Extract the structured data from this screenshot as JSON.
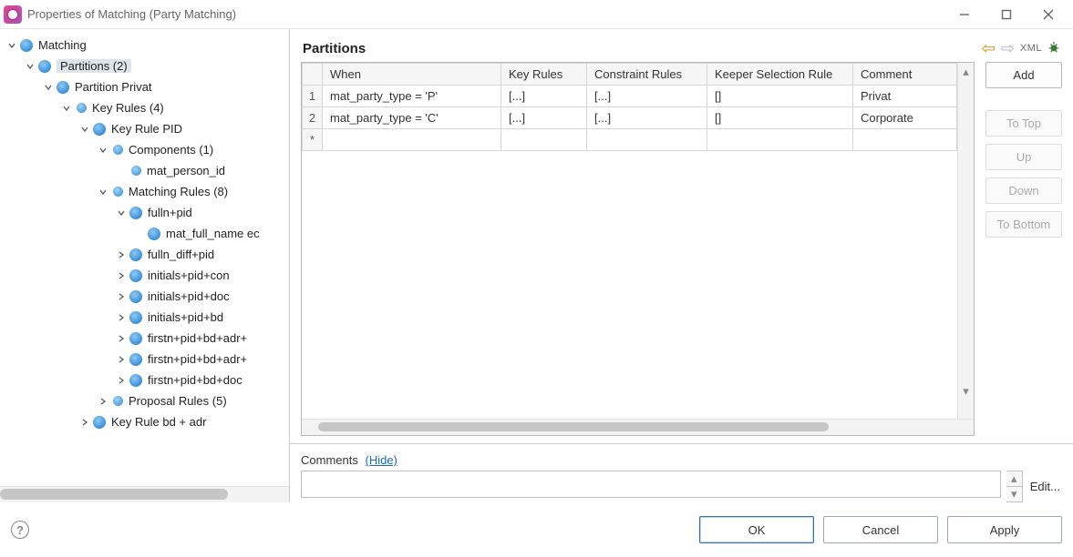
{
  "window": {
    "title": "Properties of Matching (Party Matching)"
  },
  "tree": {
    "nodes": [
      {
        "indent": 0,
        "exp": "open",
        "icon": "db",
        "label": "Matching",
        "sel": false
      },
      {
        "indent": 1,
        "exp": "open",
        "icon": "db",
        "label": "Partitions (2)",
        "sel": true
      },
      {
        "indent": 2,
        "exp": "open",
        "icon": "db",
        "label": "Partition Privat",
        "sel": false
      },
      {
        "indent": 3,
        "exp": "open",
        "icon": "sm",
        "label": "Key Rules (4)",
        "sel": false
      },
      {
        "indent": 4,
        "exp": "open",
        "icon": "db",
        "label": "Key Rule PID",
        "sel": false
      },
      {
        "indent": 5,
        "exp": "open",
        "icon": "sm",
        "label": "Components (1)",
        "sel": false
      },
      {
        "indent": 6,
        "exp": "none",
        "icon": "sm",
        "label": "mat_person_id",
        "sel": false
      },
      {
        "indent": 5,
        "exp": "open",
        "icon": "sm",
        "label": "Matching Rules (8)",
        "sel": false
      },
      {
        "indent": 6,
        "exp": "open",
        "icon": "db",
        "label": "fulln+pid",
        "sel": false
      },
      {
        "indent": 7,
        "exp": "none",
        "icon": "db",
        "label": "mat_full_name ec",
        "sel": false
      },
      {
        "indent": 6,
        "exp": "closed",
        "icon": "db",
        "label": "fulln_diff+pid",
        "sel": false
      },
      {
        "indent": 6,
        "exp": "closed",
        "icon": "db",
        "label": "initials+pid+con",
        "sel": false
      },
      {
        "indent": 6,
        "exp": "closed",
        "icon": "db",
        "label": "initials+pid+doc",
        "sel": false
      },
      {
        "indent": 6,
        "exp": "closed",
        "icon": "db",
        "label": "initials+pid+bd",
        "sel": false
      },
      {
        "indent": 6,
        "exp": "closed",
        "icon": "db",
        "label": "firstn+pid+bd+adr+",
        "sel": false
      },
      {
        "indent": 6,
        "exp": "closed",
        "icon": "db",
        "label": "firstn+pid+bd+adr+",
        "sel": false
      },
      {
        "indent": 6,
        "exp": "closed",
        "icon": "db",
        "label": "firstn+pid+bd+doc",
        "sel": false
      },
      {
        "indent": 5,
        "exp": "closed",
        "icon": "sm",
        "label": "Proposal Rules (5)",
        "sel": false
      },
      {
        "indent": 4,
        "exp": "closed",
        "icon": "db",
        "label": "Key Rule bd + adr",
        "sel": false
      }
    ]
  },
  "right": {
    "heading": "Partitions",
    "xml_label": "XML"
  },
  "table": {
    "columns": [
      "When",
      "Key Rules",
      "Constraint Rules",
      "Keeper Selection Rule",
      "Comment"
    ],
    "rows": [
      {
        "num": "1",
        "when": "mat_party_type = 'P'",
        "key": "[...]",
        "constr": "[...]",
        "keeper": "[]",
        "comment": "Privat"
      },
      {
        "num": "2",
        "when": "mat_party_type = 'C'",
        "key": "[...]",
        "constr": "[...]",
        "keeper": "[]",
        "comment": "Corporate"
      }
    ],
    "new_row_marker": "*"
  },
  "side_buttons": {
    "add": "Add",
    "top": "To Top",
    "up": "Up",
    "down": "Down",
    "bottom": "To Bottom"
  },
  "comments": {
    "label": "Comments",
    "hide": "(Hide)",
    "edit": "Edit..."
  },
  "footer": {
    "ok": "OK",
    "cancel": "Cancel",
    "apply": "Apply"
  }
}
